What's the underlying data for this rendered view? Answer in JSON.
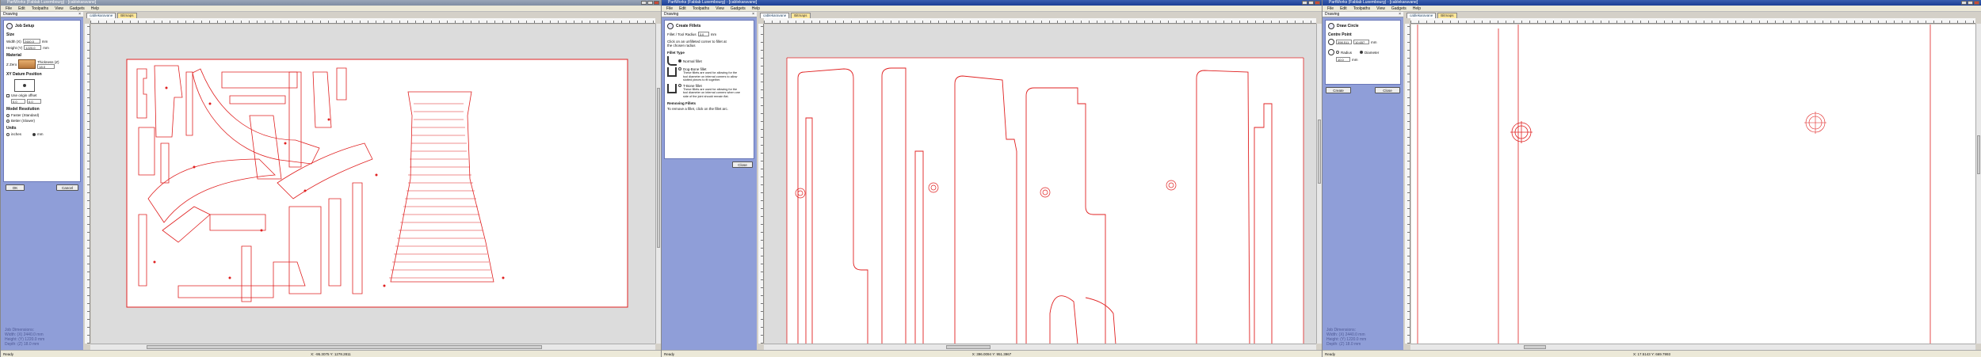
{
  "app_title": "PartWorks (Fablab Luxembourg) - [cablekaravane]",
  "menu": [
    "File",
    "Edit",
    "Toolpaths",
    "View",
    "Gadgets",
    "Help"
  ],
  "panel_title": "Drawing",
  "w1": {
    "form_title": "Job Setup",
    "size_section": "Size",
    "width_label": "Width (X)",
    "width_value": "2440.0",
    "height_label": "Height (Y)",
    "height_value": "1220.0",
    "unit": "mm",
    "material_section": "Material",
    "z_label": "Z Zero",
    "thickness_label": "Thickness (Z)",
    "thickness_value": "18.0",
    "origin_section": "XY Datum Position",
    "use_offset_label": "Use origin offset",
    "offset_x": "0.0",
    "offset_y": "0.0",
    "modeling_section": "Model Resolution",
    "opt1": "Faster (Standard)",
    "opt2": "Better (Slower)",
    "units_section": "Units",
    "units_inches": "inches",
    "units_mm": "mm",
    "ok": "OK",
    "cancel": "Cancel",
    "tab": "cablekaravane",
    "tab2": "Bitmaps",
    "info": [
      "Job Dimensions:",
      "Width: (X) 2440.0 mm",
      "Height: (Y) 1220.0 mm",
      "Depth: (Z) 18.0 mm"
    ],
    "status_left": "Ready",
    "status_coords": "X: -95.3075 Y: 1278.2811"
  },
  "w2": {
    "form_title": "Create Fillets",
    "radius_label": "Fillet / Tool Radius",
    "radius_value": "3.0",
    "unit": "mm",
    "hint": "Click on an unfilleted corner to fillet at the chosen radius",
    "types_section": "Fillet Type",
    "type1": "Normal fillet",
    "type2": "Dog-Bone fillet",
    "type2_desc": "These fillets are used for allowing for the tool diameter on internal corners to allow slotted pieces to fit together.",
    "type3": "T-Bone fillet",
    "type3_desc": "These fillets are used for allowing for the tool diameter on internal corners when one side of the joint should remain flat.",
    "remove_section": "Removing Fillets",
    "remove_text": "To remove a fillet, click on the fillet arc.",
    "close": "Close",
    "tab": "cablekaravane",
    "tab2": "Bitmaps",
    "status_left": "Ready",
    "status_coords": "X: 396.0094 Y: 951.3967"
  },
  "w3": {
    "form_title": "Draw Circle",
    "center_section": "Centre Point",
    "cx_value": "398.511",
    "cy_value": "10.657",
    "radius_label": "Radius",
    "diameter_label": "Diameter",
    "d_value": "10.0",
    "unit": "mm",
    "create": "Create",
    "close": "Close",
    "tab": "cablekaravane",
    "tab2": "Bitmaps",
    "info": [
      "Job Dimensions:",
      "Width: (X) 2440.0 mm",
      "Height: (Y) 1220.0 mm",
      "Depth: (Z) 18.0 mm"
    ],
    "status_left": "Ready",
    "status_coords": "X: 17.5143 Y: 669.7993"
  },
  "colors": {
    "panel": "#8f9ed8",
    "vector": "#e02020",
    "sheet": "#ffffff"
  }
}
